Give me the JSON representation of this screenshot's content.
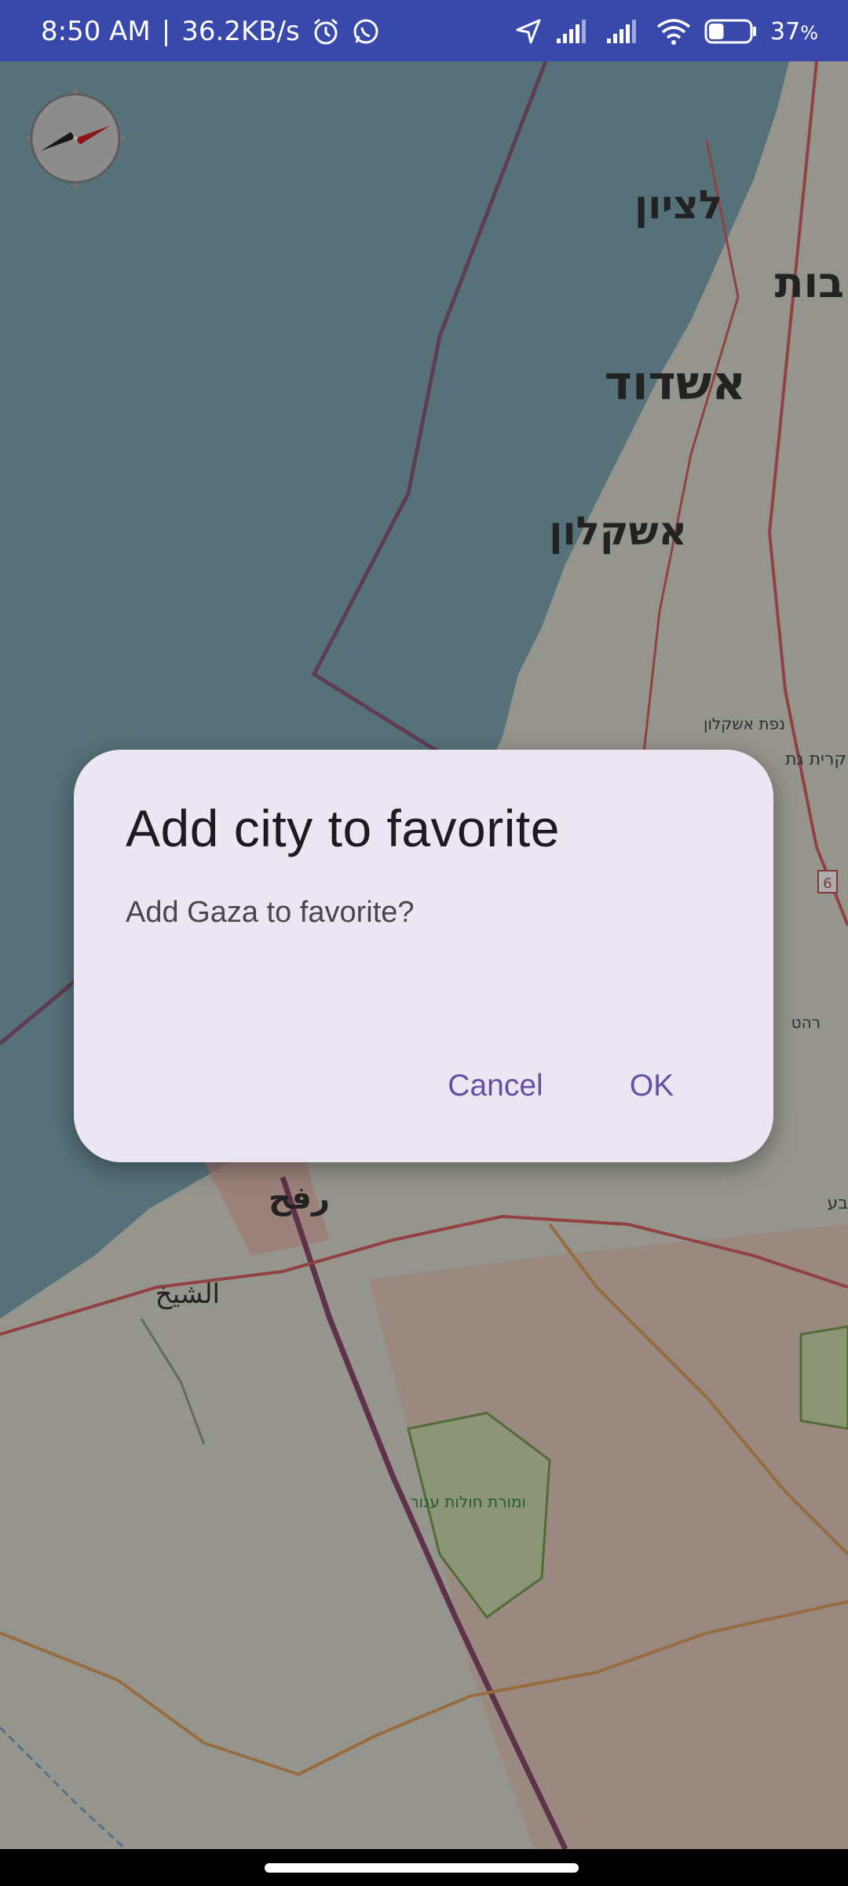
{
  "status_bar": {
    "time": "8:50 AM",
    "separator": "|",
    "network_speed": "36.2KB/s",
    "battery_percent": "37",
    "battery_unit": "%",
    "battery_level": 0.37,
    "icons": [
      "alarm-icon",
      "whatsapp-icon",
      "location-icon",
      "signal-icon",
      "signal-icon",
      "wifi-icon",
      "battery-icon"
    ]
  },
  "map": {
    "labels": {
      "ashdod": "אשדוד",
      "ashkelon": "אשקלון",
      "rishon": "לציון",
      "rehovot": "בות",
      "rafah": "رفح",
      "sheikh": "الشيخ",
      "kiryat_gat": "קרית גת",
      "nefat": "נפת אשקלון",
      "rahat": "רהט",
      "road": "6",
      "beersheba": "בע",
      "nature_reserve": "ומורת חולות עגור"
    },
    "colors": {
      "sea": "#7fa7b3",
      "land": "#dcdbd0",
      "boundary": "#8b5a7a",
      "road_orange": "#e0a060",
      "road_red": "#d86060"
    }
  },
  "dialog": {
    "title": "Add city to favorite",
    "message": "Add Gaza to favorite?",
    "cancel_label": "Cancel",
    "ok_label": "OK"
  },
  "colors": {
    "status_bar": "#3949ab",
    "dialog_background": "#ece6f2",
    "accent": "#6750a4"
  }
}
